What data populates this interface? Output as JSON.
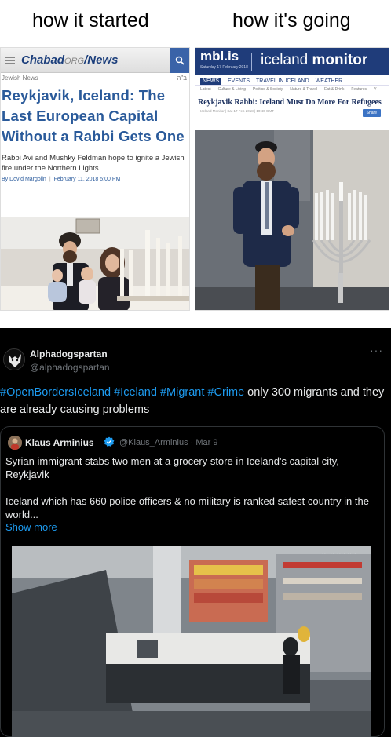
{
  "meme": {
    "caption_left": "how it started",
    "caption_right": "how it's going"
  },
  "chabad": {
    "logo": "Chabad",
    "logo_org": "ORG",
    "logo_news": "/News",
    "section": "Jewish News",
    "hebrew_mark": "ב\"ה",
    "headline": "Reykjavik, Iceland: The Last European Capital Without a Rabbi Gets One",
    "subhead": "Rabbi Avi and Mushky Feldman hope to ignite a Jewish fire under the Northern Lights",
    "author": "By Dovid Margolin",
    "date": "February 11, 2018 5:00 PM"
  },
  "mbl": {
    "logo": "mbl.is",
    "date": "Saturday 17 February 2018",
    "site_title_light": "iceland ",
    "site_title_bold": "monitor",
    "nav": [
      "NEWS",
      "EVENTS",
      "TRAVEL IN ICELAND",
      "WEATHER"
    ],
    "subnav": [
      "Latest",
      "Culture & Living",
      "Politics & Society",
      "Nature & Travel",
      "Eat & Drink",
      "Features",
      "V"
    ],
    "headline": "Reykjavik Rabbi: Iceland Must Do More For Refugees",
    "meta": "Iceland Monitor | Sat 17 Feb 2018 | 10:40 GMT",
    "share_label": "Share"
  },
  "tweet": {
    "author_name": "Alphadogspartan",
    "author_handle": "@alphadogspartan",
    "more_icon": "···",
    "hashtags": [
      "#OpenBordersIceland",
      "#Iceland",
      "#Migrant",
      "#Crime"
    ],
    "text": " only 300 migrants and they are already causing problems",
    "quote": {
      "author_name": "Klaus Arminius",
      "author_handle": "@Klaus_Arminius · Mar 9",
      "paragraph1": "Syrian immigrant stabs two men at a grocery store in Iceland's capital city, Reykjavik",
      "paragraph2": "Iceland which has 660 police officers & no military is ranked safest country in the world...",
      "show_more": "Show more",
      "video_watermark": "··· ·· ···· ····"
    }
  },
  "colors": {
    "chabad_blue": "#2a5a9a",
    "mbl_navy": "#1f3c7a",
    "twitter_blue": "#1d9bf0",
    "twitter_gray": "#71767b"
  }
}
